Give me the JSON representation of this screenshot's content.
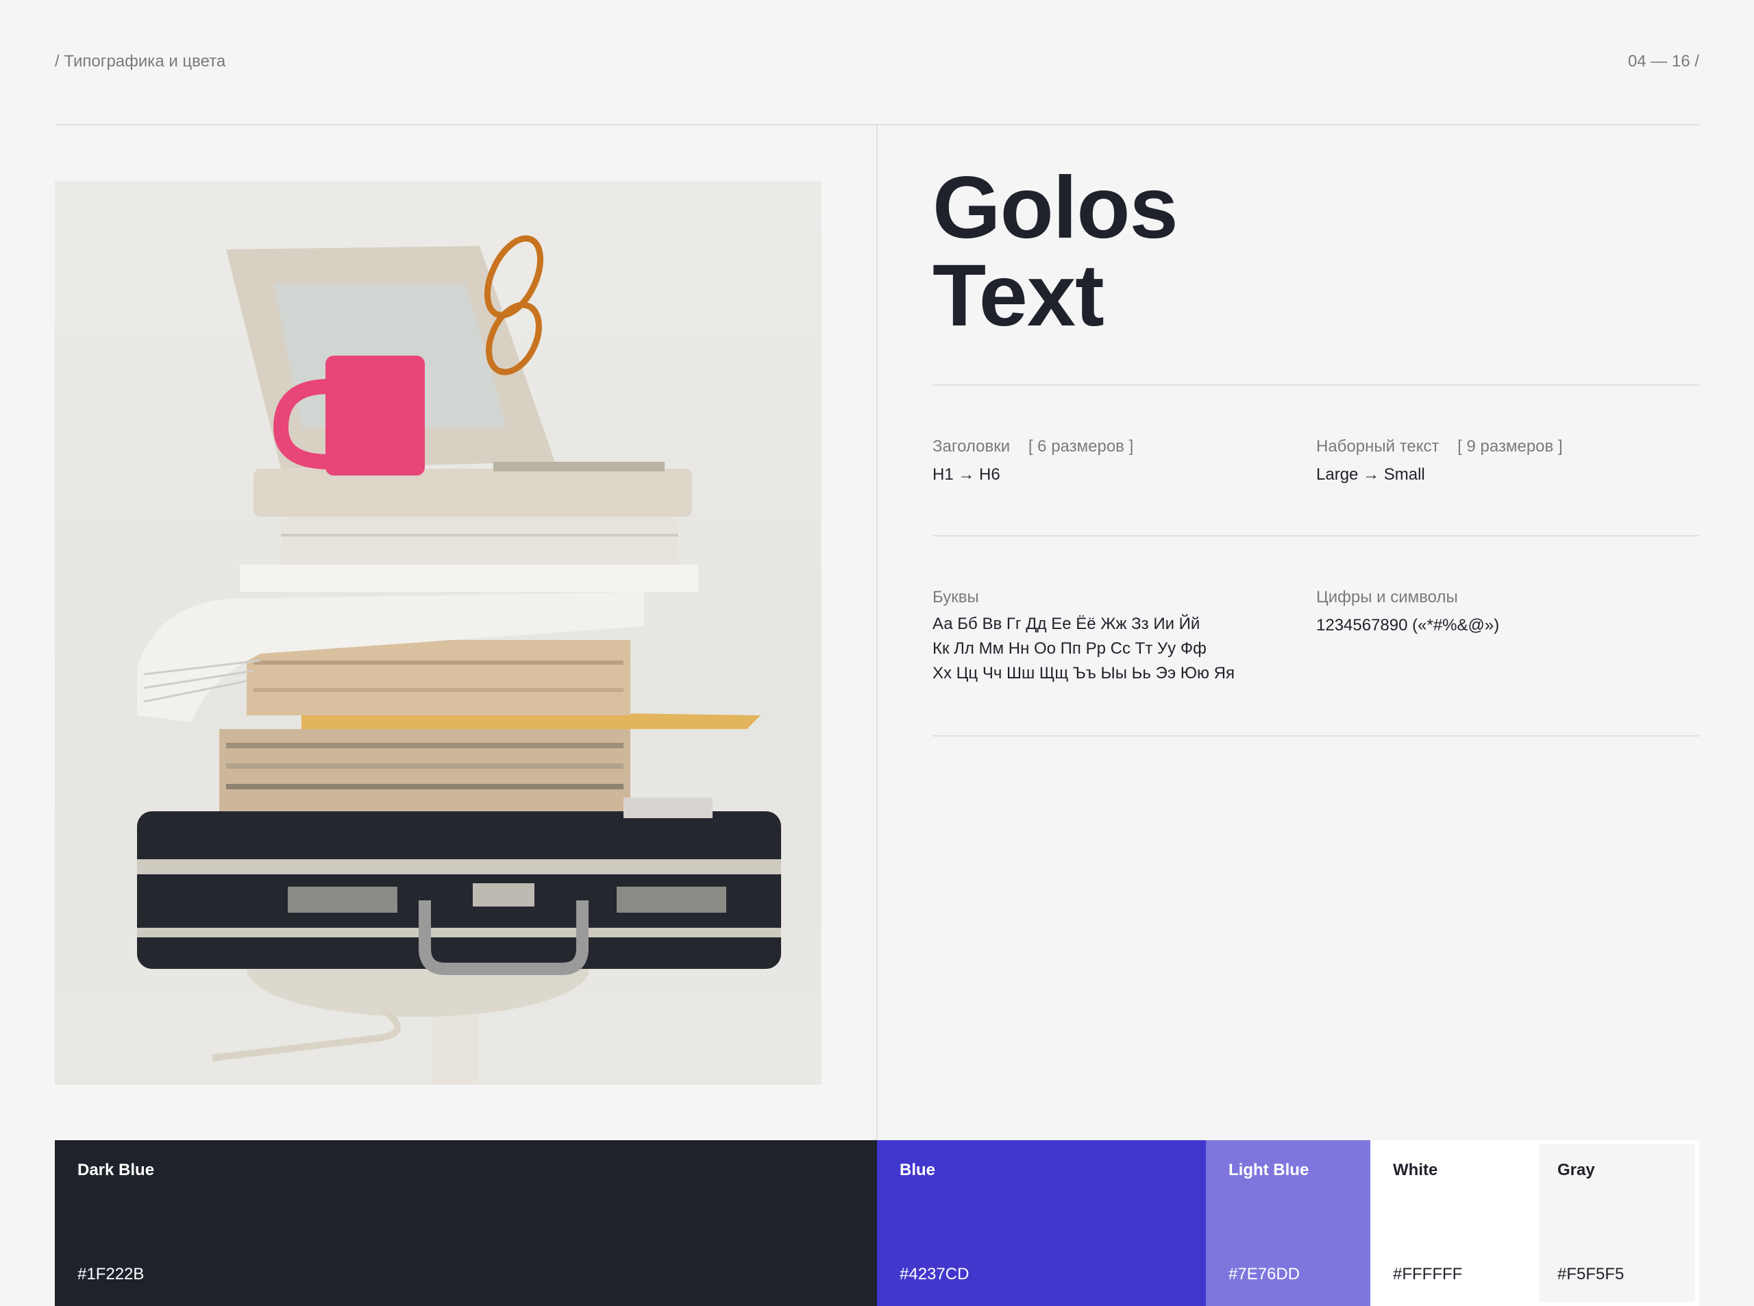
{
  "header": {
    "breadcrumb": "/ Типографика и цвета",
    "pager": "04 — 16 /"
  },
  "font": {
    "name_line1": "Golos",
    "name_line2": "Text"
  },
  "specs": {
    "headings_label": "Заголовки    [ 6 размеров ]",
    "headings_value": "H1 → H6",
    "body_label": "Наборный текст    [ 9 размеров ]",
    "body_value": "Large → Small",
    "letters_label": "Буквы",
    "letters_lines": [
      "Аа Бб Вв Гг Дд Ее Ёё Жж Зз Ии Йй",
      "Кк Лл Мм Нн Оо Пп Рр Сс Тт Уу Фф",
      "Хх Цц Чч Шш Щщ Ъъ Ыы Ьь Ээ Юю Яя"
    ],
    "digits_label": "Цифры и символы",
    "digits_value": "1234567890 («*#%&@»)"
  },
  "palette": [
    {
      "name": "Dark Blue",
      "hex": "#1F222B",
      "color": "#1F222B",
      "text_color": "#FFFFFF"
    },
    {
      "name": "Blue",
      "hex": "#4237CD",
      "color": "#4237CD",
      "text_color": "#FFFFFF"
    },
    {
      "name": "Light Blue",
      "hex": "#7E76DD",
      "color": "#7E76DD",
      "text_color": "#FFFFFF"
    },
    {
      "name": "White",
      "hex": "#FFFFFF",
      "color": "#FFFFFF",
      "text_color": "#1F222B"
    },
    {
      "name": "Gray",
      "hex": "#F5F5F5",
      "color": "#F5F5F5",
      "text_color": "#1F222B"
    }
  ]
}
